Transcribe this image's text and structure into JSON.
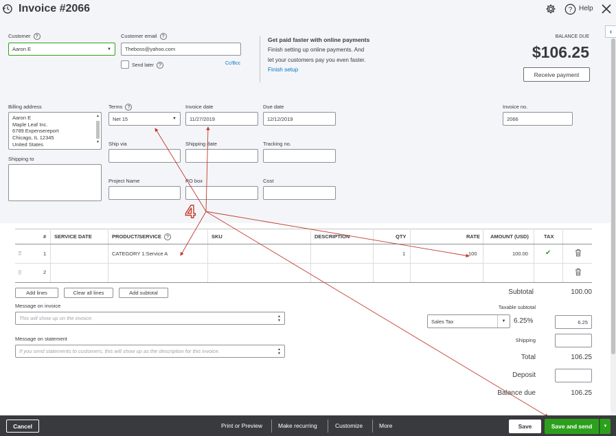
{
  "header": {
    "title": "Invoice #2066",
    "help_label": "Help"
  },
  "customer": {
    "label": "Customer",
    "value": "Aaron E",
    "email_label": "Customer email",
    "email_value": "Theboss@yahoo.com",
    "send_later_label": "Send later",
    "cc_bcc_label": "Cc/Bcc"
  },
  "promo": {
    "title": "Get paid faster with online payments",
    "line1": "Finish setting up online payments. And",
    "line2": "let your customers pay you even faster.",
    "link": "Finish setup"
  },
  "balance": {
    "label": "BALANCE DUE",
    "amount": "$106.25",
    "receive_label": "Receive payment"
  },
  "billing": {
    "label": "Billing address",
    "lines": [
      "Aaron E",
      "Maple Leaf Inc.",
      "6789 Expensereport",
      "Chicago, IL 12345",
      "United States"
    ],
    "shipping_to_label": "Shipping to"
  },
  "terms": {
    "label": "Terms",
    "value": "Net 15"
  },
  "invoice_date": {
    "label": "Invoice date",
    "value": "11/27/2019"
  },
  "due_date": {
    "label": "Due date",
    "value": "12/12/2019"
  },
  "invoice_no": {
    "label": "Invoice no.",
    "value": "2066"
  },
  "ship_via_label": "Ship via",
  "shipping_date_label": "Shipping date",
  "tracking_no_label": "Tracking no.",
  "project_name_label": "Project Name",
  "po_box_label": "PO box",
  "cost_label": "Cost",
  "annotation": "4",
  "table": {
    "headers": {
      "num": "#",
      "service_date": "SERVICE DATE",
      "product": "PRODUCT/SERVICE",
      "sku": "SKU",
      "description": "DESCRIPTION",
      "qty": "QTY",
      "rate": "RATE",
      "amount": "AMOUNT (USD)",
      "tax": "TAX"
    },
    "rows": [
      {
        "num": "1",
        "product": "CATEGORY 1:Service A",
        "qty": "1",
        "rate": "100",
        "amount": "100.00"
      },
      {
        "num": "2",
        "product": "",
        "qty": "",
        "rate": "",
        "amount": ""
      }
    ]
  },
  "line_buttons": {
    "add_lines": "Add lines",
    "clear_all": "Clear all lines",
    "add_subtotal": "Add subtotal"
  },
  "message_invoice": {
    "label": "Message on invoice",
    "placeholder": "This will show up on the invoice."
  },
  "message_statement": {
    "label": "Message on statement",
    "placeholder": "If you send statements to customers, this will show up as the description for this invoice."
  },
  "totals": {
    "subtotal_label": "Subtotal",
    "subtotal_value": "100.00",
    "taxable_label": "Taxable subtotal",
    "tax_select": "Sales Tax",
    "tax_rate": "6.25%",
    "tax_value": "6.25",
    "shipping_label": "Shipping",
    "total_label": "Total",
    "total_value": "106.25",
    "deposit_label": "Deposit",
    "balance_due_label": "Balance due",
    "balance_due_value": "106.25"
  },
  "footer": {
    "cancel": "Cancel",
    "print_preview": "Print or Preview",
    "make_recurring": "Make recurring",
    "customize": "Customize",
    "more": "More",
    "save": "Save",
    "save_and_send": "Save and send"
  },
  "colors": {
    "accent_green": "#2ca01c",
    "link_blue": "#0077c5",
    "arrow_red": "#c0392b",
    "footer_bg": "#393a3d"
  }
}
